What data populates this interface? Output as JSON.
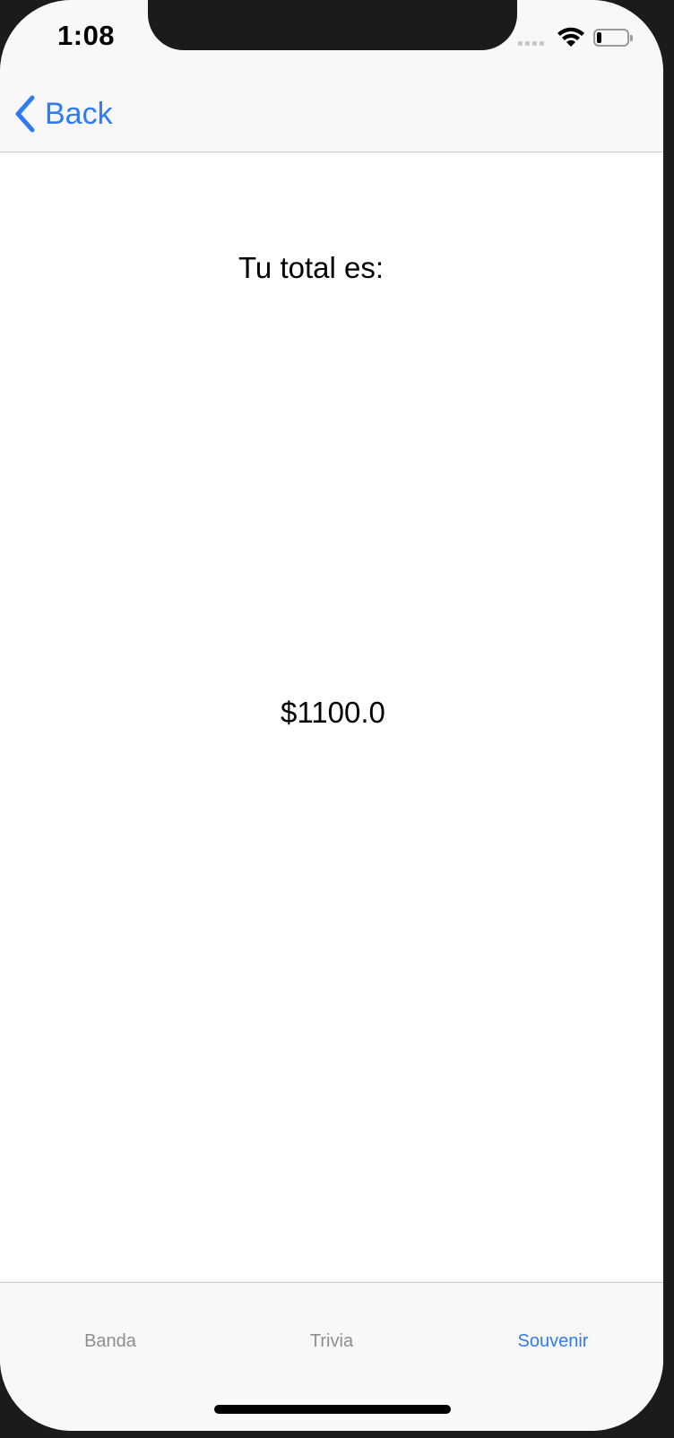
{
  "status_bar": {
    "time": "1:08",
    "signal_icon": "cellular-signal-icon",
    "wifi_icon": "wifi-icon",
    "battery_icon": "battery-icon",
    "battery_level": 0.15
  },
  "nav": {
    "back_label": "Back",
    "back_icon": "chevron-left-icon"
  },
  "main": {
    "total_label": "Tu total es:",
    "total_value": "$1100.0"
  },
  "tabs": [
    {
      "label": "Banda",
      "active": false
    },
    {
      "label": "Trivia",
      "active": false
    },
    {
      "label": "Souvenir",
      "active": true
    }
  ],
  "colors": {
    "accent": "#2f7bf5",
    "inactive_tab": "#8e8e8e",
    "bar_background": "#f8f8f8"
  }
}
